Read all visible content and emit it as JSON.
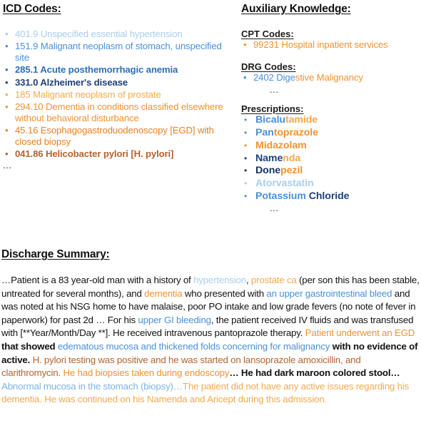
{
  "palette": {
    "blue_faint": "#a8cdef",
    "blue_light": "#7eb3e4",
    "blue_mid": "#4a90d9",
    "blue_strong": "#2f6fb5",
    "blue_dark": "#1f3f79",
    "blue_navy": "#16305f",
    "orange_faint": "#f6c98b",
    "orange_light": "#f4a94e",
    "orange_mid": "#f0922f",
    "orange_strong": "#e8801f",
    "orange_deep": "#d9701a",
    "orange_brown": "#b5622c",
    "black": "#111111"
  },
  "icd": {
    "header": "ICD Codes:",
    "items": [
      {
        "bullet_color": "#a8cdef",
        "color": "#a8cdef",
        "text": "401.9 Unspecified essential hypertension",
        "weight": "500"
      },
      {
        "bullet_color": "#4a90d9",
        "color": "#4a90d9",
        "text": "151.9 Malignant neoplasm of stomach, unspecified site",
        "weight": "500"
      },
      {
        "bullet_color": "#2f6fb5",
        "color": "#2f6fb5",
        "text": "285.1 Acute posthemorrhagic anemia",
        "weight": "700"
      },
      {
        "bullet_color": "#1f3f79",
        "color": "#1f3f79",
        "text": "331.0 Alzheimer's disease",
        "weight": "700"
      },
      {
        "bullet_color": "#f4a94e",
        "color": "#f4a94e",
        "text": "185 Malignant neoplasm of prostate",
        "weight": "500"
      },
      {
        "bullet_color": "#f0922f",
        "color": "#f0922f",
        "text": "294.10 Dementia in conditions classified elsewhere without behavioral disturbance",
        "weight": "500"
      },
      {
        "bullet_color": "#e8801f",
        "color": "#e8801f",
        "text": "45.16 Esophagogastroduodenoscopy [EGD] with closed biopsy",
        "weight": "500"
      },
      {
        "bullet_color": "#b5622c",
        "color": "#b5622c",
        "text": "041.86 Helicobacter pylori [H. pylori]",
        "weight": "700"
      }
    ],
    "trailing_ellipsis": "..."
  },
  "auxiliary": {
    "header": "Auxiliary Knowledge:",
    "cpt": {
      "header": "CPT Codes:",
      "items": [
        {
          "bullet_color": "#f0922f",
          "color": "#f0922f",
          "text": "99231 Hospital inpatient services"
        }
      ]
    },
    "drg": {
      "header": "DRG Codes:",
      "items": [
        {
          "bullet_color": "#4a90d9",
          "segments": [
            {
              "text": "2402 Dige",
              "color": "#4a90d9"
            },
            {
              "text": "stive Malignancy",
              "color": "#f0922f"
            }
          ]
        }
      ],
      "trailing_ellipsis": "..."
    },
    "prescriptions": {
      "header": "Prescriptions:",
      "items": [
        {
          "bullet_color": "#4a90d9",
          "segments": [
            {
              "text": "Bicalu",
              "color": "#4a90d9"
            },
            {
              "text": "tamide",
              "color": "#f4a94e"
            }
          ]
        },
        {
          "bullet_color": "#4a90d9",
          "segments": [
            {
              "text": "Pan",
              "color": "#4a90d9"
            },
            {
              "text": "toprazole",
              "color": "#f0922f"
            }
          ]
        },
        {
          "bullet_color": "#f0922f",
          "segments": [
            {
              "text": "Midazolam",
              "color": "#f0922f"
            }
          ]
        },
        {
          "bullet_color": "#1f3f79",
          "segments": [
            {
              "text": "Name",
              "color": "#1f3f79"
            },
            {
              "text": "nda",
              "color": "#f4a94e"
            }
          ]
        },
        {
          "bullet_color": "#16305f",
          "segments": [
            {
              "text": "Done",
              "color": "#16305f"
            },
            {
              "text": "pezil",
              "color": "#f0922f"
            }
          ]
        },
        {
          "bullet_color": "#a8cdef",
          "segments": [
            {
              "text": "Atorvastatin",
              "color": "#a8cdef"
            }
          ]
        },
        {
          "bullet_color": "#4a90d9",
          "segments": [
            {
              "text": "Potassium ",
              "color": "#4a90d9"
            },
            {
              "text": "Chloride",
              "color": "#1f3f79"
            }
          ]
        }
      ],
      "trailing_ellipsis": "..."
    }
  },
  "summary": {
    "header": "Discharge Summary:",
    "segments": [
      {
        "text": "…Patient is a 83 year-old man with a history of ",
        "color": "#111111",
        "weight": "400"
      },
      {
        "text": "hypertension",
        "color": "#a8cdef",
        "weight": "400"
      },
      {
        "text": ", ",
        "color": "#111111",
        "weight": "400"
      },
      {
        "text": "prostate ca",
        "color": "#f4a94e",
        "weight": "400"
      },
      {
        "text": " (per son this has been stable, untreated for several months), and ",
        "color": "#111111",
        "weight": "400"
      },
      {
        "text": "dementia",
        "color": "#f0922f",
        "weight": "400"
      },
      {
        "text": " who presented with ",
        "color": "#111111",
        "weight": "400"
      },
      {
        "text": "an upper gastrointestinal bleed",
        "color": "#4a90d9",
        "weight": "400"
      },
      {
        "text": " and was noted at his NSG home to have malaise, poor PO intake and low grade fevers (no note of fever in paperwork) for past 2d … For his ",
        "color": "#111111",
        "weight": "400"
      },
      {
        "text": "upper GI bleeding",
        "color": "#4a90d9",
        "weight": "400"
      },
      {
        "text": ", the patient received IV fluids and was transfused with [**Year/Month/Day **]. He received intravenous pantoprazole therapy. ",
        "color": "#111111",
        "weight": "400"
      },
      {
        "text": "Patient underwent an EGD",
        "color": "#f0922f",
        "weight": "400"
      },
      {
        "text": " that showed ",
        "color": "#111111",
        "weight": "700"
      },
      {
        "text": "edematous mucosa and thickened folds concerning for malignancy",
        "color": "#4a90d9",
        "weight": "400"
      },
      {
        "text": " with no evidence of active. ",
        "color": "#111111",
        "weight": "700"
      },
      {
        "text": "H. pylori testing was positive and he was started on lansoprazole  amoxicillin, and clarithromycin.",
        "color": "#b5622c",
        "weight": "400"
      },
      {
        "text": " ",
        "color": "#111111",
        "weight": "400"
      },
      {
        "text": "He had biopsies taken during endoscopy",
        "color": "#f0922f",
        "weight": "400"
      },
      {
        "text": "… ",
        "color": "#111111",
        "weight": "700"
      },
      {
        "text": "He had dark maroon colored stool…",
        "color": "#111111",
        "weight": "700"
      },
      {
        "text": " ",
        "color": "#111111",
        "weight": "400"
      },
      {
        "text": "Abnormal mucosa in the stomach (biopsy)…",
        "color": "#7eb3e4",
        "weight": "400"
      },
      {
        "text": "The patient did not have any active issues regarding his dementia. He was continued on his Namenda and Aricept during this admission.",
        "color": "#f4a94e",
        "weight": "400"
      }
    ]
  }
}
